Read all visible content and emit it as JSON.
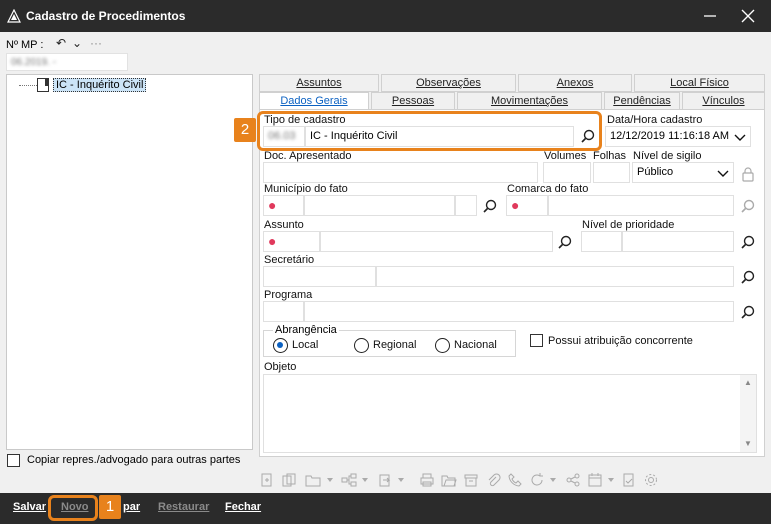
{
  "window": {
    "title": "Cadastro de Procedimentos"
  },
  "mp": {
    "label": "Nº MP :",
    "value": "06.2019.  -",
    "dots": "···"
  },
  "tree": {
    "item_label": "IC - Inquérito Civil"
  },
  "copy_check": {
    "label": "Copiar repres./advogado para outras partes",
    "checked": false
  },
  "tabs_top": [
    "Assuntos",
    "Observações",
    "Anexos",
    "Local Físico"
  ],
  "tabs_bottom": [
    "Dados Gerais",
    "Pessoas",
    "Movimentações",
    "Pendências",
    "Vínculos"
  ],
  "active_tab": "Dados Gerais",
  "form": {
    "tipo_cadastro_label": "Tipo de cadastro",
    "tipo_cadastro_code": "06.03",
    "tipo_cadastro_value": "IC - Inquérito Civil",
    "data_hora_label": "Data/Hora cadastro",
    "data_hora_value": "12/12/2019 11:16:18 AM",
    "doc_apresentado_label": "Doc. Apresentado",
    "volumes_label": "Volumes",
    "folhas_label": "Folhas",
    "nivel_sigilo_label": "Nível de sigilo",
    "nivel_sigilo_value": "Público",
    "municipio_label": "Município do fato",
    "comarca_label": "Comarca do fato",
    "assunto_label": "Assunto",
    "nivel_prioridade_label": "Nível de prioridade",
    "secretario_label": "Secretário",
    "programa_label": "Programa",
    "abrangencia_label": "Abrangência",
    "abrangencia_options": [
      "Local",
      "Regional",
      "Nacional"
    ],
    "abrangencia_selected": "Local",
    "atribuicao_label": "Possui atribuição concorrente",
    "objeto_label": "Objeto",
    "required_mark": "●"
  },
  "badges": {
    "one": "1",
    "two": "2"
  },
  "bottom_buttons": [
    {
      "label": "Salvar",
      "enabled": true
    },
    {
      "label": "Novo",
      "enabled": false
    },
    {
      "label": "par",
      "enabled": true
    },
    {
      "label": "Restaurar",
      "enabled": false
    },
    {
      "label": "Fechar",
      "enabled": true
    }
  ],
  "colors": {
    "accent_orange": "#e8821c",
    "titlebar": "#2b2b2b",
    "active_tab_text": "#0b61c2",
    "required": "#e0395c"
  }
}
